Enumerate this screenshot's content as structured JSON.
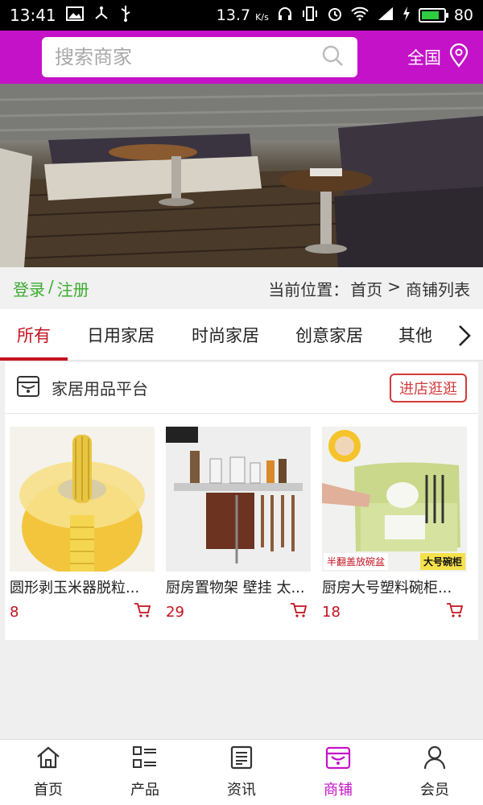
{
  "statusbar": {
    "time": "13:41",
    "speed": "13.7",
    "speed_unit": "K/s",
    "battery": "80",
    "battery_level": 0.8
  },
  "search": {
    "placeholder": "搜索商家"
  },
  "region": {
    "label": "全国"
  },
  "infobar": {
    "login": "登录",
    "sep": "/",
    "register": "注册",
    "location_label": "当前位置：",
    "home": "首页",
    "arrow": ">",
    "current": "商铺列表"
  },
  "tabs": [
    {
      "label": "所有",
      "active": true
    },
    {
      "label": "日用家居"
    },
    {
      "label": "时尚家居"
    },
    {
      "label": "创意家居"
    },
    {
      "label": "其他"
    }
  ],
  "shop": {
    "name": "家居用品平台",
    "visit_label": "进店逛逛"
  },
  "products": [
    {
      "title": "圆形剥玉米器脱粒...",
      "price": "8"
    },
    {
      "title": "厨房置物架 壁挂 太...",
      "price": "29"
    },
    {
      "title": "厨房大号塑料碗柜...",
      "price": "18",
      "badge_left": "半翻盖放碗盆",
      "badge_right": "大号碗柜"
    }
  ],
  "bottomnav": [
    {
      "label": "首页",
      "icon": "home-icon"
    },
    {
      "label": "产品",
      "icon": "grid-list-icon"
    },
    {
      "label": "资讯",
      "icon": "news-icon"
    },
    {
      "label": "商铺",
      "icon": "store-icon",
      "active": true
    },
    {
      "label": "会员",
      "icon": "user-icon"
    }
  ],
  "colors": {
    "brand": "#c412c9",
    "accent_red": "#c4121f",
    "login_green": "#3cab2f"
  }
}
